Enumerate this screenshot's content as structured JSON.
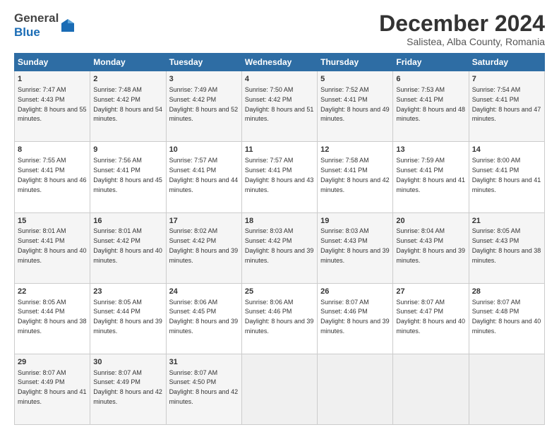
{
  "logo": {
    "line1": "General",
    "line2": "Blue"
  },
  "title": "December 2024",
  "subtitle": "Salistea, Alba County, Romania",
  "weekdays": [
    "Sunday",
    "Monday",
    "Tuesday",
    "Wednesday",
    "Thursday",
    "Friday",
    "Saturday"
  ],
  "weeks": [
    [
      {
        "day": "1",
        "sunrise": "7:47 AM",
        "sunset": "4:43 PM",
        "daylight": "8 hours and 55 minutes."
      },
      {
        "day": "2",
        "sunrise": "7:48 AM",
        "sunset": "4:42 PM",
        "daylight": "8 hours and 54 minutes."
      },
      {
        "day": "3",
        "sunrise": "7:49 AM",
        "sunset": "4:42 PM",
        "daylight": "8 hours and 52 minutes."
      },
      {
        "day": "4",
        "sunrise": "7:50 AM",
        "sunset": "4:42 PM",
        "daylight": "8 hours and 51 minutes."
      },
      {
        "day": "5",
        "sunrise": "7:52 AM",
        "sunset": "4:41 PM",
        "daylight": "8 hours and 49 minutes."
      },
      {
        "day": "6",
        "sunrise": "7:53 AM",
        "sunset": "4:41 PM",
        "daylight": "8 hours and 48 minutes."
      },
      {
        "day": "7",
        "sunrise": "7:54 AM",
        "sunset": "4:41 PM",
        "daylight": "8 hours and 47 minutes."
      }
    ],
    [
      {
        "day": "8",
        "sunrise": "7:55 AM",
        "sunset": "4:41 PM",
        "daylight": "8 hours and 46 minutes."
      },
      {
        "day": "9",
        "sunrise": "7:56 AM",
        "sunset": "4:41 PM",
        "daylight": "8 hours and 45 minutes."
      },
      {
        "day": "10",
        "sunrise": "7:57 AM",
        "sunset": "4:41 PM",
        "daylight": "8 hours and 44 minutes."
      },
      {
        "day": "11",
        "sunrise": "7:57 AM",
        "sunset": "4:41 PM",
        "daylight": "8 hours and 43 minutes."
      },
      {
        "day": "12",
        "sunrise": "7:58 AM",
        "sunset": "4:41 PM",
        "daylight": "8 hours and 42 minutes."
      },
      {
        "day": "13",
        "sunrise": "7:59 AM",
        "sunset": "4:41 PM",
        "daylight": "8 hours and 41 minutes."
      },
      {
        "day": "14",
        "sunrise": "8:00 AM",
        "sunset": "4:41 PM",
        "daylight": "8 hours and 41 minutes."
      }
    ],
    [
      {
        "day": "15",
        "sunrise": "8:01 AM",
        "sunset": "4:41 PM",
        "daylight": "8 hours and 40 minutes."
      },
      {
        "day": "16",
        "sunrise": "8:01 AM",
        "sunset": "4:42 PM",
        "daylight": "8 hours and 40 minutes."
      },
      {
        "day": "17",
        "sunrise": "8:02 AM",
        "sunset": "4:42 PM",
        "daylight": "8 hours and 39 minutes."
      },
      {
        "day": "18",
        "sunrise": "8:03 AM",
        "sunset": "4:42 PM",
        "daylight": "8 hours and 39 minutes."
      },
      {
        "day": "19",
        "sunrise": "8:03 AM",
        "sunset": "4:43 PM",
        "daylight": "8 hours and 39 minutes."
      },
      {
        "day": "20",
        "sunrise": "8:04 AM",
        "sunset": "4:43 PM",
        "daylight": "8 hours and 39 minutes."
      },
      {
        "day": "21",
        "sunrise": "8:05 AM",
        "sunset": "4:43 PM",
        "daylight": "8 hours and 38 minutes."
      }
    ],
    [
      {
        "day": "22",
        "sunrise": "8:05 AM",
        "sunset": "4:44 PM",
        "daylight": "8 hours and 38 minutes."
      },
      {
        "day": "23",
        "sunrise": "8:05 AM",
        "sunset": "4:44 PM",
        "daylight": "8 hours and 39 minutes."
      },
      {
        "day": "24",
        "sunrise": "8:06 AM",
        "sunset": "4:45 PM",
        "daylight": "8 hours and 39 minutes."
      },
      {
        "day": "25",
        "sunrise": "8:06 AM",
        "sunset": "4:46 PM",
        "daylight": "8 hours and 39 minutes."
      },
      {
        "day": "26",
        "sunrise": "8:07 AM",
        "sunset": "4:46 PM",
        "daylight": "8 hours and 39 minutes."
      },
      {
        "day": "27",
        "sunrise": "8:07 AM",
        "sunset": "4:47 PM",
        "daylight": "8 hours and 40 minutes."
      },
      {
        "day": "28",
        "sunrise": "8:07 AM",
        "sunset": "4:48 PM",
        "daylight": "8 hours and 40 minutes."
      }
    ],
    [
      {
        "day": "29",
        "sunrise": "8:07 AM",
        "sunset": "4:49 PM",
        "daylight": "8 hours and 41 minutes."
      },
      {
        "day": "30",
        "sunrise": "8:07 AM",
        "sunset": "4:49 PM",
        "daylight": "8 hours and 42 minutes."
      },
      {
        "day": "31",
        "sunrise": "8:07 AM",
        "sunset": "4:50 PM",
        "daylight": "8 hours and 42 minutes."
      },
      null,
      null,
      null,
      null
    ]
  ],
  "labels": {
    "sunrise": "Sunrise:",
    "sunset": "Sunset:",
    "daylight": "Daylight:"
  }
}
